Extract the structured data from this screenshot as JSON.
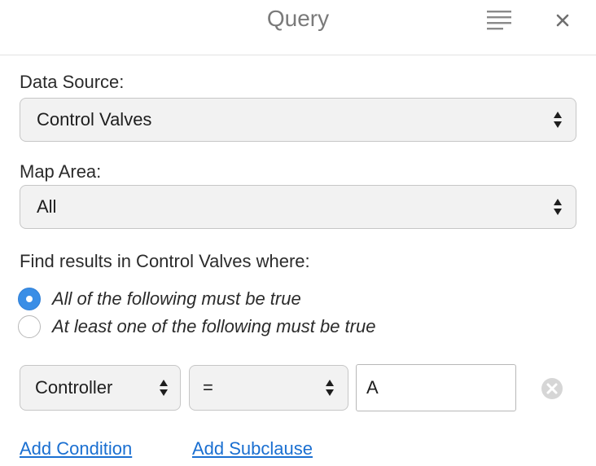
{
  "header": {
    "title": "Query",
    "menu_icon": "list-lines-icon",
    "close_icon": "close-icon"
  },
  "data_source": {
    "label": "Data Source:",
    "selected": "Control Valves"
  },
  "map_area": {
    "label": "Map Area:",
    "selected": "All"
  },
  "find_text": "Find results in Control Valves where:",
  "match_mode": {
    "options": [
      {
        "label": "All of the following must be true",
        "selected": true
      },
      {
        "label": "At least one of the following must be true",
        "selected": false
      }
    ]
  },
  "condition": {
    "field": "Controller",
    "operator": "=",
    "value": "A",
    "remove_icon": "remove-circle-icon"
  },
  "links": {
    "add_condition": "Add Condition",
    "add_subclause": "Add Subclause"
  },
  "colors": {
    "accent": "#3a8ee6",
    "link": "#1a6fd1",
    "title": "#7a7a7a"
  }
}
